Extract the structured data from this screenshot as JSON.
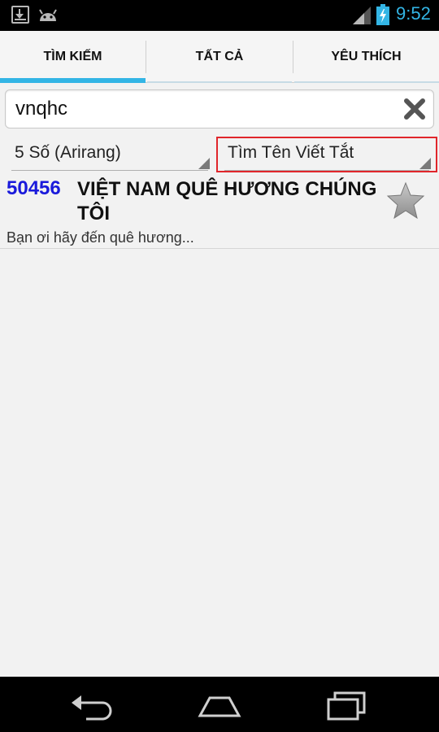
{
  "status_bar": {
    "time": "9:52",
    "icons": [
      "download-icon",
      "android-icon",
      "signal-icon",
      "battery-charging-icon"
    ],
    "accent_color": "#33b5e5"
  },
  "tabs": [
    {
      "label": "TÌM KIẾM",
      "selected": true
    },
    {
      "label": "TẤT CẢ",
      "selected": false
    },
    {
      "label": "YÊU THÍCH",
      "selected": false
    }
  ],
  "search": {
    "value": "vnqhc",
    "clear_icon": "clear-x-icon"
  },
  "filters": {
    "songbook": "5 Số (Arirang)",
    "search_mode": "Tìm Tên Viết Tắt",
    "highlight_color": "#e0262b"
  },
  "results": [
    {
      "id": "50456",
      "title": "VIỆT NAM QUÊ HƯƠNG CHÚNG TÔI",
      "lyric": "Bạn ơi hãy đến quê hương...",
      "favorite": false,
      "id_color": "#1a1adb"
    }
  ],
  "nav_bar": {
    "icons": [
      "back-icon",
      "home-icon",
      "recents-icon"
    ]
  }
}
